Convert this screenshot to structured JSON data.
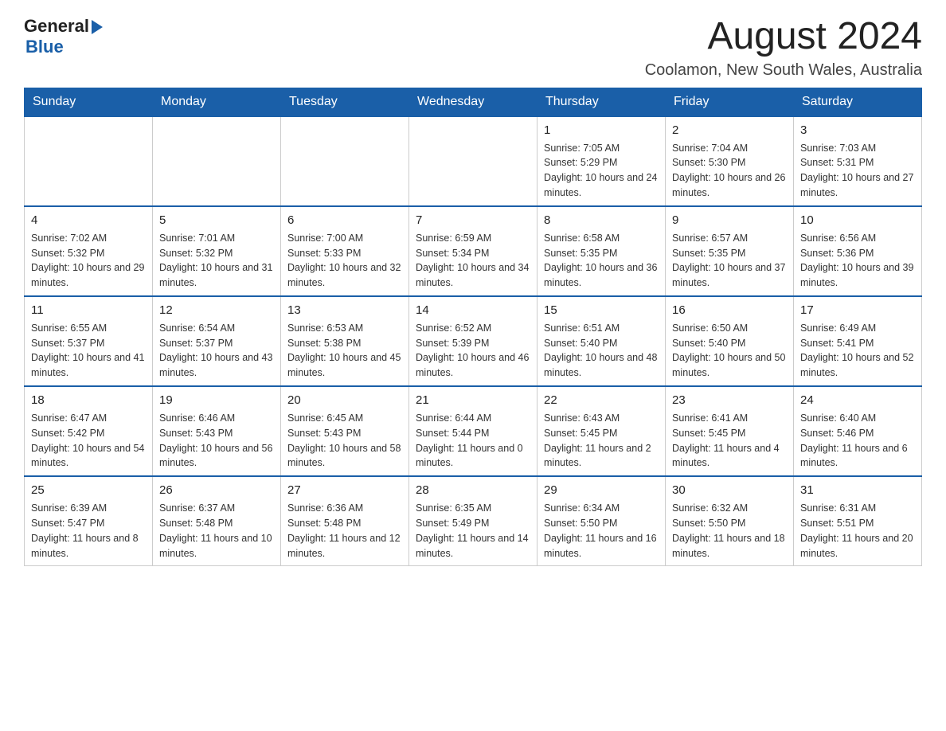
{
  "header": {
    "logo_general": "General",
    "logo_blue": "Blue",
    "month_title": "August 2024",
    "location": "Coolamon, New South Wales, Australia"
  },
  "weekdays": [
    "Sunday",
    "Monday",
    "Tuesday",
    "Wednesday",
    "Thursday",
    "Friday",
    "Saturday"
  ],
  "weeks": [
    [
      {
        "day": "",
        "info": ""
      },
      {
        "day": "",
        "info": ""
      },
      {
        "day": "",
        "info": ""
      },
      {
        "day": "",
        "info": ""
      },
      {
        "day": "1",
        "info": "Sunrise: 7:05 AM\nSunset: 5:29 PM\nDaylight: 10 hours and 24 minutes."
      },
      {
        "day": "2",
        "info": "Sunrise: 7:04 AM\nSunset: 5:30 PM\nDaylight: 10 hours and 26 minutes."
      },
      {
        "day": "3",
        "info": "Sunrise: 7:03 AM\nSunset: 5:31 PM\nDaylight: 10 hours and 27 minutes."
      }
    ],
    [
      {
        "day": "4",
        "info": "Sunrise: 7:02 AM\nSunset: 5:32 PM\nDaylight: 10 hours and 29 minutes."
      },
      {
        "day": "5",
        "info": "Sunrise: 7:01 AM\nSunset: 5:32 PM\nDaylight: 10 hours and 31 minutes."
      },
      {
        "day": "6",
        "info": "Sunrise: 7:00 AM\nSunset: 5:33 PM\nDaylight: 10 hours and 32 minutes."
      },
      {
        "day": "7",
        "info": "Sunrise: 6:59 AM\nSunset: 5:34 PM\nDaylight: 10 hours and 34 minutes."
      },
      {
        "day": "8",
        "info": "Sunrise: 6:58 AM\nSunset: 5:35 PM\nDaylight: 10 hours and 36 minutes."
      },
      {
        "day": "9",
        "info": "Sunrise: 6:57 AM\nSunset: 5:35 PM\nDaylight: 10 hours and 37 minutes."
      },
      {
        "day": "10",
        "info": "Sunrise: 6:56 AM\nSunset: 5:36 PM\nDaylight: 10 hours and 39 minutes."
      }
    ],
    [
      {
        "day": "11",
        "info": "Sunrise: 6:55 AM\nSunset: 5:37 PM\nDaylight: 10 hours and 41 minutes."
      },
      {
        "day": "12",
        "info": "Sunrise: 6:54 AM\nSunset: 5:37 PM\nDaylight: 10 hours and 43 minutes."
      },
      {
        "day": "13",
        "info": "Sunrise: 6:53 AM\nSunset: 5:38 PM\nDaylight: 10 hours and 45 minutes."
      },
      {
        "day": "14",
        "info": "Sunrise: 6:52 AM\nSunset: 5:39 PM\nDaylight: 10 hours and 46 minutes."
      },
      {
        "day": "15",
        "info": "Sunrise: 6:51 AM\nSunset: 5:40 PM\nDaylight: 10 hours and 48 minutes."
      },
      {
        "day": "16",
        "info": "Sunrise: 6:50 AM\nSunset: 5:40 PM\nDaylight: 10 hours and 50 minutes."
      },
      {
        "day": "17",
        "info": "Sunrise: 6:49 AM\nSunset: 5:41 PM\nDaylight: 10 hours and 52 minutes."
      }
    ],
    [
      {
        "day": "18",
        "info": "Sunrise: 6:47 AM\nSunset: 5:42 PM\nDaylight: 10 hours and 54 minutes."
      },
      {
        "day": "19",
        "info": "Sunrise: 6:46 AM\nSunset: 5:43 PM\nDaylight: 10 hours and 56 minutes."
      },
      {
        "day": "20",
        "info": "Sunrise: 6:45 AM\nSunset: 5:43 PM\nDaylight: 10 hours and 58 minutes."
      },
      {
        "day": "21",
        "info": "Sunrise: 6:44 AM\nSunset: 5:44 PM\nDaylight: 11 hours and 0 minutes."
      },
      {
        "day": "22",
        "info": "Sunrise: 6:43 AM\nSunset: 5:45 PM\nDaylight: 11 hours and 2 minutes."
      },
      {
        "day": "23",
        "info": "Sunrise: 6:41 AM\nSunset: 5:45 PM\nDaylight: 11 hours and 4 minutes."
      },
      {
        "day": "24",
        "info": "Sunrise: 6:40 AM\nSunset: 5:46 PM\nDaylight: 11 hours and 6 minutes."
      }
    ],
    [
      {
        "day": "25",
        "info": "Sunrise: 6:39 AM\nSunset: 5:47 PM\nDaylight: 11 hours and 8 minutes."
      },
      {
        "day": "26",
        "info": "Sunrise: 6:37 AM\nSunset: 5:48 PM\nDaylight: 11 hours and 10 minutes."
      },
      {
        "day": "27",
        "info": "Sunrise: 6:36 AM\nSunset: 5:48 PM\nDaylight: 11 hours and 12 minutes."
      },
      {
        "day": "28",
        "info": "Sunrise: 6:35 AM\nSunset: 5:49 PM\nDaylight: 11 hours and 14 minutes."
      },
      {
        "day": "29",
        "info": "Sunrise: 6:34 AM\nSunset: 5:50 PM\nDaylight: 11 hours and 16 minutes."
      },
      {
        "day": "30",
        "info": "Sunrise: 6:32 AM\nSunset: 5:50 PM\nDaylight: 11 hours and 18 minutes."
      },
      {
        "day": "31",
        "info": "Sunrise: 6:31 AM\nSunset: 5:51 PM\nDaylight: 11 hours and 20 minutes."
      }
    ]
  ]
}
